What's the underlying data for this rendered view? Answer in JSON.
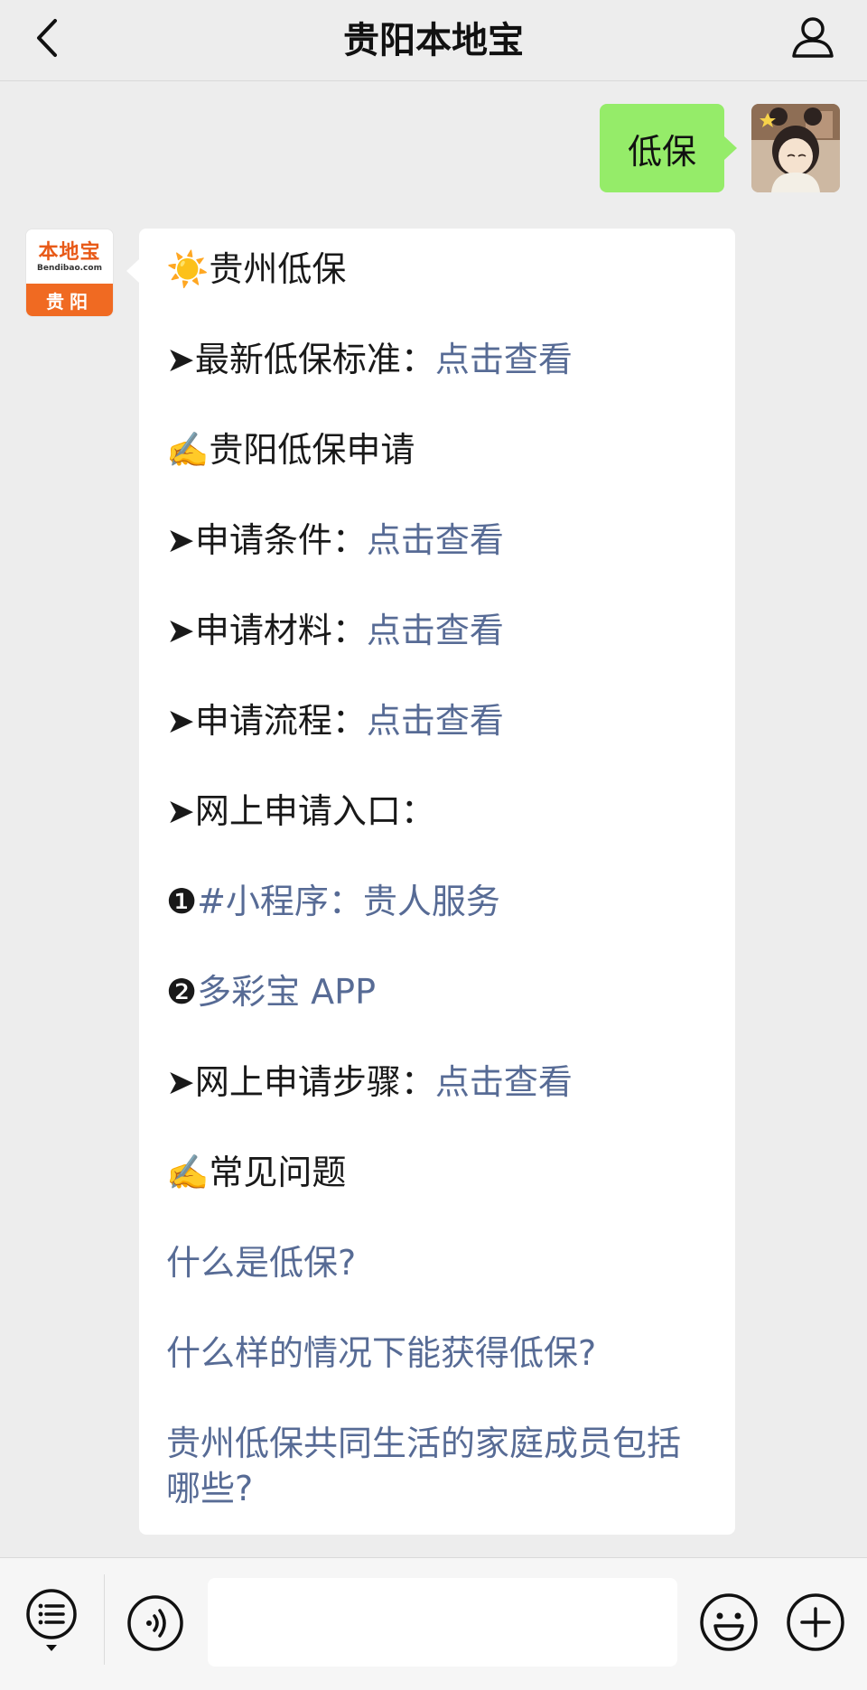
{
  "header": {
    "title": "贵阳本地宝"
  },
  "outgoing_message": {
    "text": "低保"
  },
  "sender_avatar": {
    "brand_name": "本地宝",
    "brand_domain": "Bendibao.com",
    "city": "贵阳"
  },
  "incoming_message": {
    "lines": [
      {
        "icon": "☀️",
        "text": "贵州低保",
        "link": ""
      },
      {
        "prefix": "➤",
        "text": "最新低保标准：",
        "link": "点击查看"
      },
      {
        "icon": "✍️",
        "text": "贵阳低保申请",
        "link": ""
      },
      {
        "prefix": "➤",
        "text": "申请条件：",
        "link": "点击查看"
      },
      {
        "prefix": "➤",
        "text": "申请材料：",
        "link": "点击查看"
      },
      {
        "prefix": "➤",
        "text": "申请流程：",
        "link": "点击查看"
      },
      {
        "prefix": "➤",
        "text": "网上申请入口：",
        "link": ""
      },
      {
        "prefix": "❶",
        "text": "",
        "link": "#小程序：贵人服务"
      },
      {
        "prefix": "❷",
        "text": "",
        "link": "多彩宝 APP"
      },
      {
        "prefix": "➤",
        "text": "网上申请步骤：",
        "link": "点击查看"
      },
      {
        "icon": "✍️",
        "text": "常见问题",
        "link": ""
      },
      {
        "prefix": "",
        "text": "",
        "link": "什么是低保?"
      },
      {
        "prefix": "",
        "text": "",
        "link": "什么样的情况下能获得低保?"
      },
      {
        "prefix": "",
        "text": "",
        "link": "贵州低保共同生活的家庭成员包括哪些?"
      }
    ]
  },
  "input_bar": {
    "text_value": ""
  },
  "colors": {
    "background": "#ededed",
    "outgoing_bubble": "#95ec69",
    "link": "#576b95",
    "brand_orange": "#f06a22"
  }
}
